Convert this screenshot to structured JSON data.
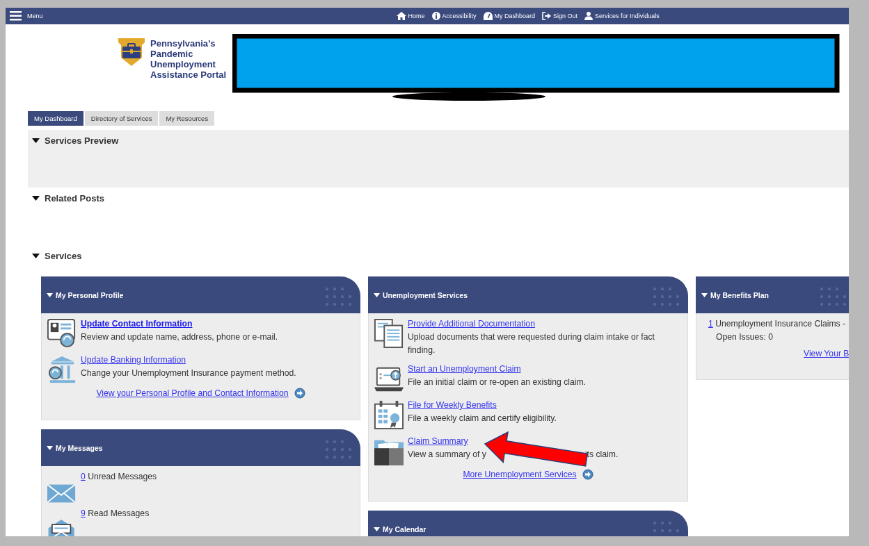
{
  "nav": {
    "menu_label": "Menu",
    "links": [
      {
        "label": "Home"
      },
      {
        "label": "Accessibility"
      },
      {
        "label": "My Dashboard"
      },
      {
        "label": "Sign Out"
      },
      {
        "label": "Services for Individuals"
      }
    ]
  },
  "logo": {
    "lines": [
      "Pennsylvania’s",
      "Pandemic",
      "Unemployment",
      "Assistance Portal"
    ]
  },
  "tabs": [
    {
      "label": "My Dashboard",
      "selected": true
    },
    {
      "label": "Directory of Services",
      "selected": false
    },
    {
      "label": "My Resources",
      "selected": false
    }
  ],
  "sections": [
    {
      "title": "Services Preview",
      "expanded": true,
      "shaded": true
    },
    {
      "title": "Related Posts",
      "expanded": true,
      "shaded": false
    },
    {
      "title": "Services",
      "expanded": true,
      "shaded": false
    }
  ],
  "columns": [
    [
      {
        "title": "My Personal Profile",
        "kind": "services",
        "items": [
          {
            "link": "Update Contact Information",
            "bold": true,
            "description": [
              "Review and update name, address, phone or e-mail."
            ]
          },
          {
            "link": "Update Banking Information",
            "bold": false,
            "description": [
              "Change your Unemployment Insurance payment method."
            ]
          }
        ],
        "footer_link": "View your Personal Profile and Contact Information"
      },
      {
        "title": "My Messages",
        "kind": "messages",
        "items": [
          {
            "count": "0",
            "label": "Unread Messages"
          },
          {
            "count": "9",
            "label": "Read Messages"
          }
        ]
      }
    ],
    [
      {
        "title": "Unemployment Services",
        "kind": "services",
        "items": [
          {
            "link": "Provide Additional Documentation",
            "bold": false,
            "description": [
              "Upload documents that were requested during claim intake or fact finding."
            ]
          },
          {
            "link": "Start an Unemployment Claim",
            "bold": false,
            "description": [
              "File an initial claim or re-open an existing claim."
            ]
          },
          {
            "link": "File for Weekly Benefits",
            "bold": false,
            "description": [
              "File a weekly claim and certify eligibility."
            ]
          },
          {
            "link": "Claim Summary",
            "bold": false,
            "description": [
              "View a summary of y",
              "its claim."
            ]
          }
        ],
        "footer_link": "More Unemployment Services"
      },
      {
        "title": "My Calendar",
        "kind": "empty"
      }
    ],
    [
      {
        "title": "My Benefits Plan",
        "kind": "plan",
        "items": [
          {
            "count": "1",
            "label": "Unemployment Insurance Claims -",
            "detail": "Open Issues: 0"
          }
        ],
        "footer_link": "View Your B"
      }
    ]
  ]
}
